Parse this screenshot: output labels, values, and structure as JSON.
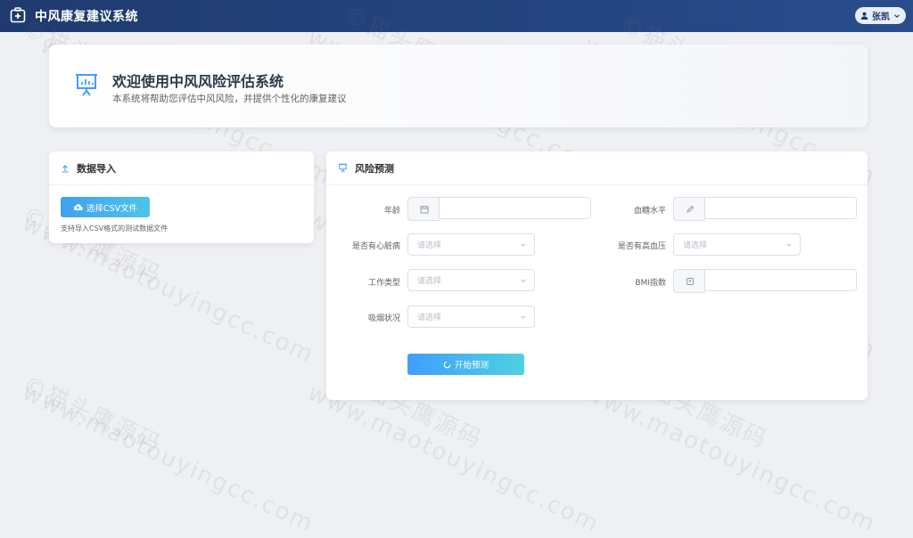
{
  "header": {
    "app_title": "中风康复建议系统",
    "user_name": "张凯"
  },
  "welcome": {
    "title": "欢迎使用中风风险评估系统",
    "subtitle": "本系统将帮助您评估中风风险，并提供个性化的康复建议"
  },
  "import_card": {
    "title": "数据导入",
    "button_label": "选择CSV文件",
    "hint": "支持导入CSV格式的测试数据文件"
  },
  "risk_card": {
    "title": "风险预测",
    "fields": {
      "age": {
        "label": "年龄",
        "value": ""
      },
      "glucose": {
        "label": "血糖水平",
        "value": ""
      },
      "heart_disease": {
        "label": "是否有心脏病",
        "placeholder": "请选择"
      },
      "hypertension": {
        "label": "是否有高血压",
        "placeholder": "请选择"
      },
      "work_type": {
        "label": "工作类型",
        "placeholder": "请选择"
      },
      "bmi": {
        "label": "BMI指数",
        "value": ""
      },
      "smoking": {
        "label": "吸烟状况",
        "placeholder": "请选择"
      }
    },
    "predict_button": "开始预测"
  },
  "watermark": {
    "line1": "©猫头鹰源码",
    "line2": "www.maotouyingcc.com"
  },
  "colors": {
    "header_bg": "#1f3a6e",
    "accent": "#409eff"
  }
}
